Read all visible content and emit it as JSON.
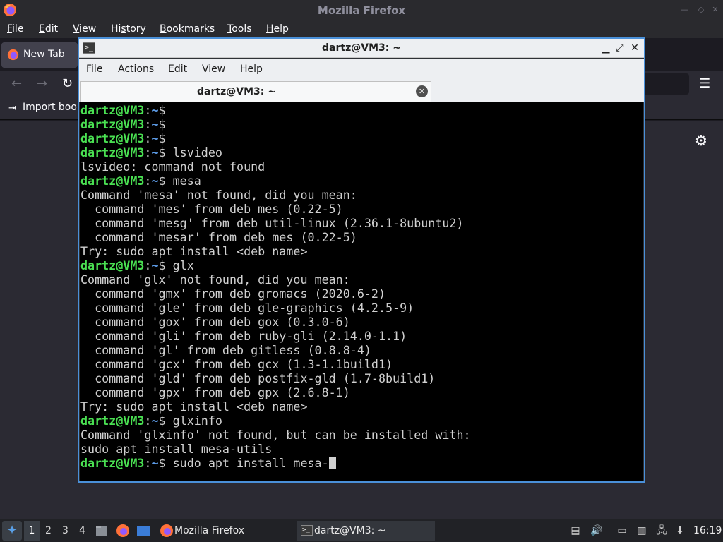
{
  "firefox": {
    "window_title": "Mozilla Firefox",
    "menu": [
      "File",
      "Edit",
      "View",
      "History",
      "Bookmarks",
      "Tools",
      "Help"
    ],
    "menu_underline": [
      "F",
      "E",
      "V",
      "s",
      "B",
      "T",
      "H"
    ],
    "tab_label": "New Tab",
    "import_bookmarks_label": "Import book",
    "icons": {
      "logo": "firefox-logo-icon",
      "back": "back-arrow-icon",
      "forward": "forward-arrow-icon",
      "reload": "reload-icon",
      "menu": "hamburger-menu-icon",
      "settings": "gear-icon"
    }
  },
  "terminal": {
    "title": "dartz@VM3: ~",
    "menu": [
      "File",
      "Actions",
      "Edit",
      "View",
      "Help"
    ],
    "tab_label": "dartz@VM3: ~",
    "prompt_user": "dartz@VM3",
    "prompt_sep": ":",
    "prompt_path": "~",
    "prompt_end": "$",
    "lines": [
      {
        "type": "prompt",
        "cmd": ""
      },
      {
        "type": "prompt",
        "cmd": ""
      },
      {
        "type": "prompt",
        "cmd": ""
      },
      {
        "type": "prompt",
        "cmd": " lsvideo"
      },
      {
        "type": "out",
        "text": "lsvideo: command not found"
      },
      {
        "type": "prompt",
        "cmd": " mesa"
      },
      {
        "type": "out",
        "text": "Command 'mesa' not found, did you mean:"
      },
      {
        "type": "out",
        "text": "  command 'mes' from deb mes (0.22-5)"
      },
      {
        "type": "out",
        "text": "  command 'mesg' from deb util-linux (2.36.1-8ubuntu2)"
      },
      {
        "type": "out",
        "text": "  command 'mesar' from deb mes (0.22-5)"
      },
      {
        "type": "out",
        "text": "Try: sudo apt install <deb name>"
      },
      {
        "type": "prompt",
        "cmd": " glx"
      },
      {
        "type": "out",
        "text": "Command 'glx' not found, did you mean:"
      },
      {
        "type": "out",
        "text": "  command 'gmx' from deb gromacs (2020.6-2)"
      },
      {
        "type": "out",
        "text": "  command 'gle' from deb gle-graphics (4.2.5-9)"
      },
      {
        "type": "out",
        "text": "  command 'gox' from deb gox (0.3.0-6)"
      },
      {
        "type": "out",
        "text": "  command 'gli' from deb ruby-gli (2.14.0-1.1)"
      },
      {
        "type": "out",
        "text": "  command 'gl' from deb gitless (0.8.8-4)"
      },
      {
        "type": "out",
        "text": "  command 'gcx' from deb gcx (1.3-1.1build1)"
      },
      {
        "type": "out",
        "text": "  command 'gld' from deb postfix-gld (1.7-8build1)"
      },
      {
        "type": "out",
        "text": "  command 'gpx' from deb gpx (2.6.8-1)"
      },
      {
        "type": "out",
        "text": "Try: sudo apt install <deb name>"
      },
      {
        "type": "prompt",
        "cmd": " glxinfo"
      },
      {
        "type": "out",
        "text": "Command 'glxinfo' not found, but can be installed with:"
      },
      {
        "type": "out",
        "text": "sudo apt install mesa-utils"
      },
      {
        "type": "prompt",
        "cmd": " sudo apt install mesa-",
        "cursor": true
      }
    ]
  },
  "taskbar": {
    "workspaces": [
      "1",
      "2",
      "3",
      "4"
    ],
    "tasks": [
      {
        "label": "Mozilla Firefox",
        "icon": "firefox-icon"
      },
      {
        "label": "dartz@VM3: ~",
        "icon": "terminal-icon"
      }
    ],
    "launchers": [
      "file-manager-icon",
      "firefox-icon",
      "desktop-icon"
    ],
    "tray": [
      "clipboard-icon",
      "volume-icon",
      "display-icon",
      "notes-icon",
      "network-icon",
      "updates-icon"
    ],
    "clock": "16:19"
  },
  "colors": {
    "prompt_user": "#4ae052",
    "prompt_path": "#5c9be6",
    "terminal_bg": "#000000",
    "terminal_fg": "#d0d0d0",
    "active_border": "#4a90d9"
  }
}
